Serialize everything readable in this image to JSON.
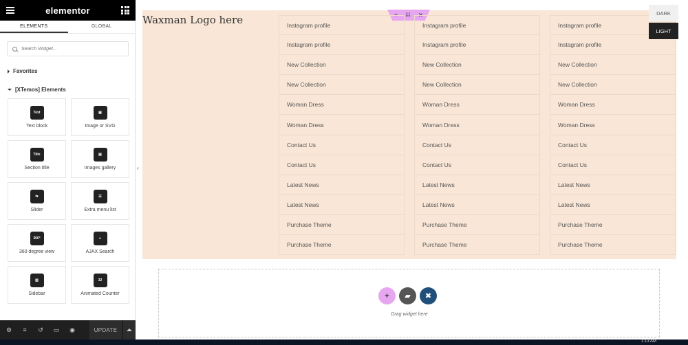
{
  "panel": {
    "brand": "elementor",
    "tabs": [
      "ELEMENTS",
      "GLOBAL"
    ],
    "search_placeholder": "Search Widget...",
    "favorites_label": "Favorites",
    "xtemos_label": "[XTemos] Elements",
    "widgets": [
      {
        "label": "Text block",
        "icon": "text-block-icon",
        "glyph": "Text"
      },
      {
        "label": "Image or SVG",
        "icon": "image-svg-icon",
        "glyph": "▣"
      },
      {
        "label": "Section title",
        "icon": "section-title-icon",
        "glyph": "Title"
      },
      {
        "label": "Images gallery",
        "icon": "images-gallery-icon",
        "glyph": "▤"
      },
      {
        "label": "Slider",
        "icon": "slider-icon",
        "glyph": "⇆"
      },
      {
        "label": "Extra menu list",
        "icon": "extra-menu-list-icon",
        "glyph": "☰"
      },
      {
        "label": "360 degree view",
        "icon": "360-view-icon",
        "glyph": "360°"
      },
      {
        "label": "AJAX Search",
        "icon": "ajax-search-icon",
        "glyph": "⌕"
      },
      {
        "label": "Sidebar",
        "icon": "sidebar-icon",
        "glyph": "▥"
      },
      {
        "label": "Animated Counter",
        "icon": "animated-counter-icon",
        "glyph": "32"
      }
    ],
    "footer_update": "UPDATE"
  },
  "canvas": {
    "logo_text": "Waxman Logo here",
    "menu_items": [
      "Instagram profile",
      "Instagram profile",
      "New Collection",
      "New Collection",
      "Woman Dress",
      "Woman Dress",
      "Contact Us",
      "Contact Us",
      "Latest News",
      "Latest News",
      "Purchase Theme",
      "Purchase Theme"
    ],
    "mode_dark": "DARK",
    "mode_light": "LIGHT",
    "dropzone_text": "Drag widget here"
  },
  "taskbar": {
    "time": "1:13 AM"
  },
  "colors": {
    "section_bg": "#f9e6d6",
    "accent_pink": "#e7a6f0",
    "panel_dark": "#000000"
  }
}
